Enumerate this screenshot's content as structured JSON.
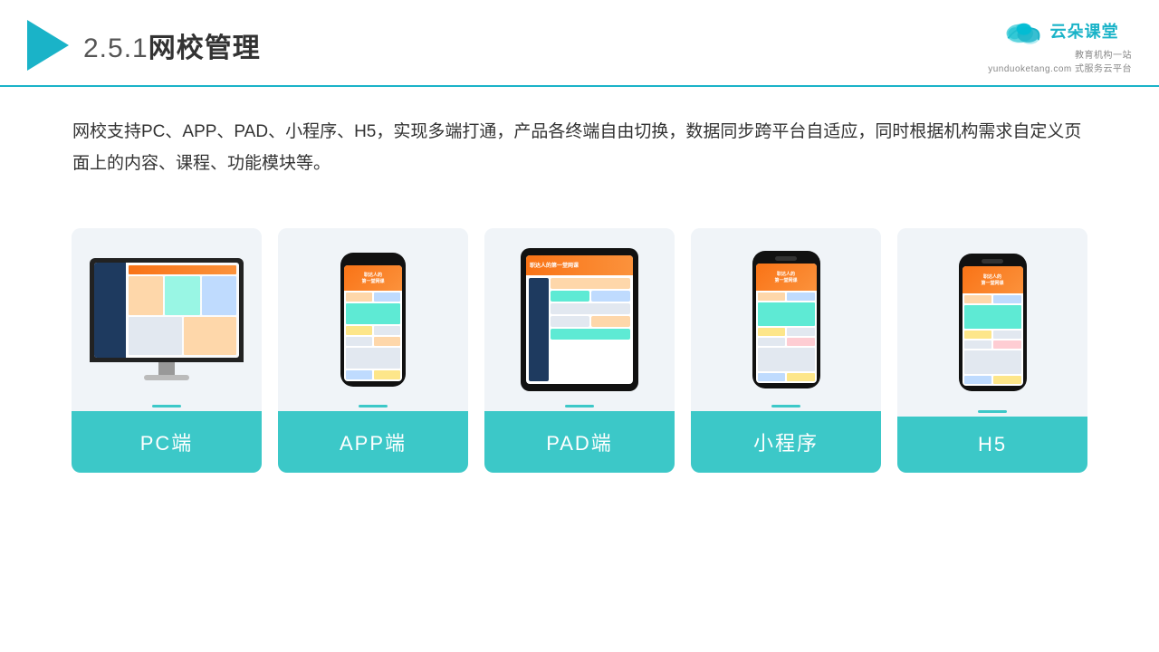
{
  "header": {
    "title": "网校管理",
    "number": "2.5.1",
    "logo_main": "云朵课堂",
    "logo_url": "yunduoketang.com",
    "logo_sub1": "教育机构一站",
    "logo_sub2": "式服务云平台"
  },
  "description": {
    "text": "网校支持PC、APP、PAD、小程序、H5，实现多端打通，产品各终端自由切换，数据同步跨平台自适应，同时根据机构需求自定义页面上的内容、课程、功能模块等。"
  },
  "cards": [
    {
      "id": "pc",
      "label": "PC端",
      "device": "pc"
    },
    {
      "id": "app",
      "label": "APP端",
      "device": "phone"
    },
    {
      "id": "pad",
      "label": "PAD端",
      "device": "tablet"
    },
    {
      "id": "miniapp",
      "label": "小程序",
      "device": "small-phone"
    },
    {
      "id": "h5",
      "label": "H5",
      "device": "small-phone"
    }
  ],
  "colors": {
    "accent": "#1ab3c8",
    "card_bg": "#eef2f7",
    "label_bg": "#3cc8c8",
    "label_text": "#ffffff"
  }
}
